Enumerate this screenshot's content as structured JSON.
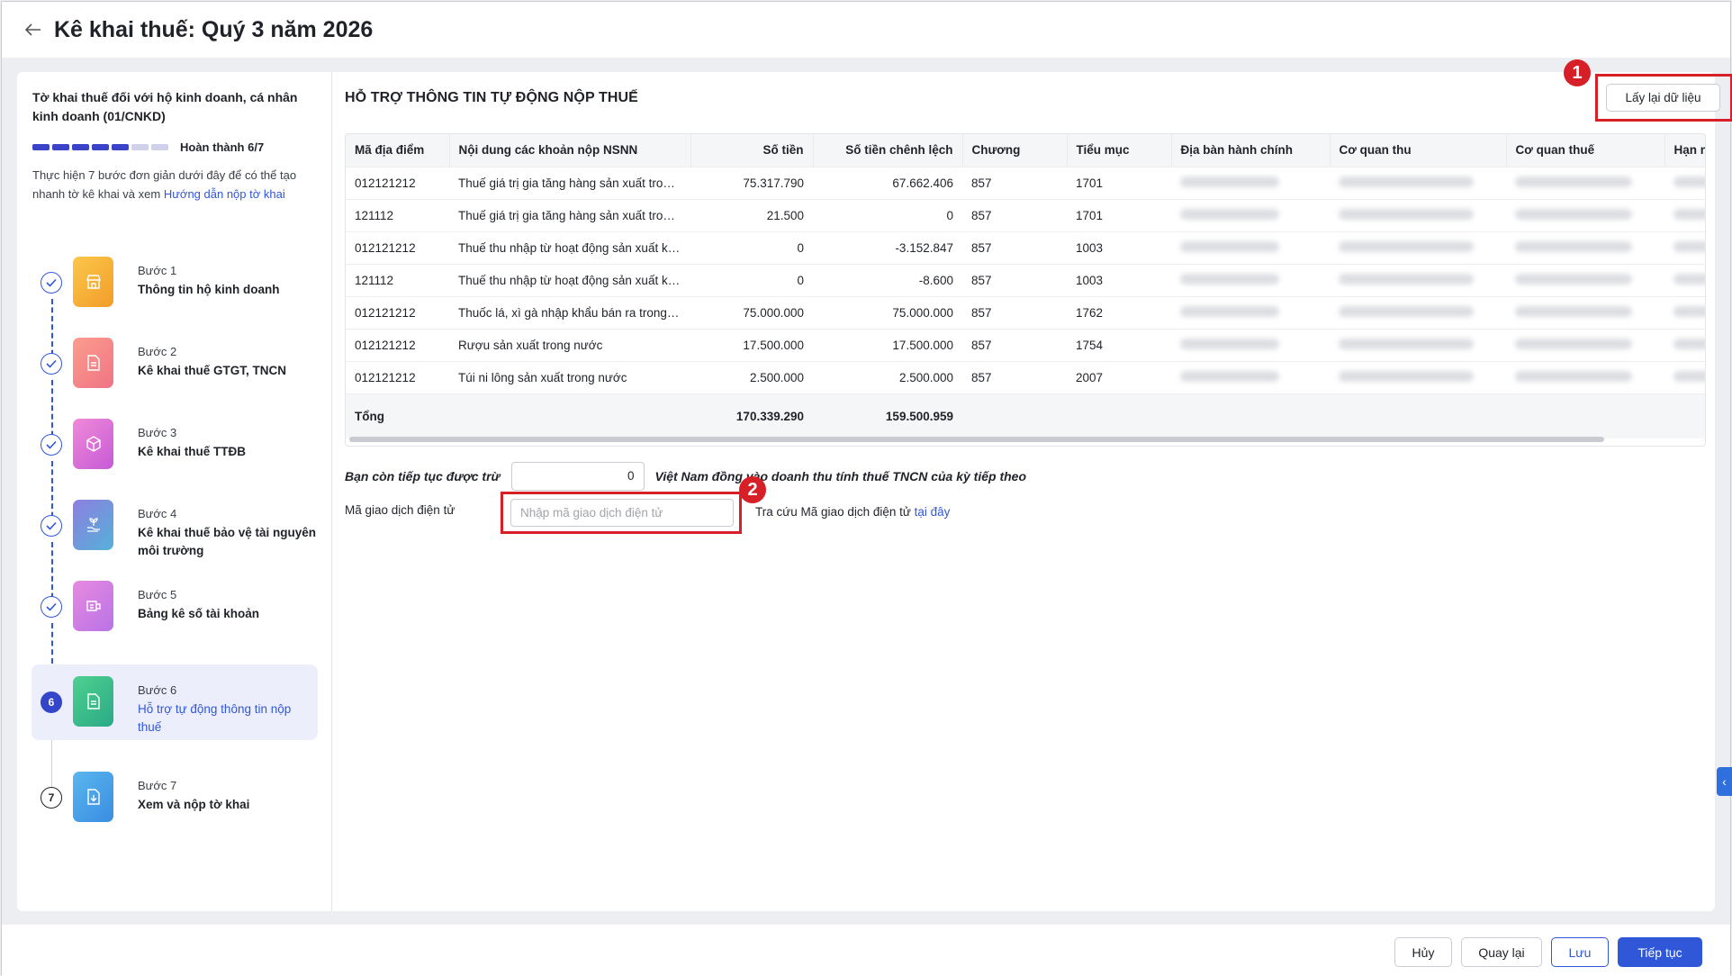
{
  "header": {
    "title": "Kê khai thuế: Quý 3 năm 2026"
  },
  "sidebar": {
    "form_title": "Tờ khai thuế đối với hộ kinh doanh, cá nhân kinh doanh (01/CNKD)",
    "progress": {
      "label": "Hoàn thành 6/7",
      "done": 6,
      "total": 7
    },
    "desc_prefix": "Thực hiện 7 bước đơn giản dưới đây để có thể tạo nhanh tờ kê khai và xem ",
    "desc_link": "Hướng dẫn nộp tờ khai",
    "steps": [
      {
        "label": "Bước 1",
        "name": "Thông tin hộ kinh doanh",
        "status": "done",
        "color": "#f7b23b"
      },
      {
        "label": "Bước 2",
        "name": "Kê khai thuế GTGT, TNCN",
        "status": "done",
        "color": "#f58a85"
      },
      {
        "label": "Bước 3",
        "name": "Kê khai thuế TTĐB",
        "status": "done",
        "color": "#e16fd0"
      },
      {
        "label": "Bước 4",
        "name": "Kê khai thuế bảo vệ tài nguyên môi trường",
        "status": "done",
        "color": "#7a86e0"
      },
      {
        "label": "Bước 5",
        "name": "Bảng kê số tài khoản",
        "status": "done",
        "color": "#d97fe0"
      },
      {
        "label": "Bước 6",
        "name": "Hỗ trợ tự động thông tin nộp thuế",
        "status": "active",
        "number": "6",
        "color": "#3fbf8a"
      },
      {
        "label": "Bước 7",
        "name": "Xem và nộp tờ khai",
        "status": "todo",
        "number": "7",
        "color": "#4aa6e8"
      }
    ]
  },
  "content": {
    "section_title": "HỖ TRỢ THÔNG TIN TỰ ĐỘNG NỘP THUẾ",
    "refetch_label": "Lấy lại dữ liệu",
    "badges": [
      "1",
      "2"
    ],
    "table": {
      "columns": [
        "Mã địa điểm",
        "Nội dung các khoản nộp NSNN",
        "Số tiền",
        "Số tiền chênh lệch",
        "Chương",
        "Tiểu mục",
        "Địa bàn hành chính",
        "Cơ quan thu",
        "Cơ quan thuế",
        "Hạn n"
      ],
      "rows": [
        [
          "012121212",
          "Thuế giá trị gia tăng hàng sản xuất trong nước",
          "75.317.790",
          "67.662.406",
          "857",
          "1701"
        ],
        [
          "121112",
          "Thuế giá trị gia tăng hàng sản xuất trong nước",
          "21.500",
          "0",
          "857",
          "1701"
        ],
        [
          "012121212",
          "Thuế thu nhập từ hoạt động sản xuất kinh doanh",
          "0",
          "-3.152.847",
          "857",
          "1003"
        ],
        [
          "121112",
          "Thuế thu nhập từ hoạt động sản xuất kinh doanh",
          "0",
          "-8.600",
          "857",
          "1003"
        ],
        [
          "012121212",
          "Thuốc lá, xì gà nhập khẩu bán ra trong nước",
          "75.000.000",
          "75.000.000",
          "857",
          "1762"
        ],
        [
          "012121212",
          "Rượu sản xuất trong nước",
          "17.500.000",
          "17.500.000",
          "857",
          "1754"
        ],
        [
          "012121212",
          "Túi ni lông sản xuất trong nước",
          "2.500.000",
          "2.500.000",
          "857",
          "2007"
        ]
      ],
      "total": {
        "label": "Tổng",
        "amount": "170.339.290",
        "diff": "159.500.959"
      }
    },
    "carry_over": {
      "prefix": "Bạn còn tiếp tục được trừ",
      "value": "0",
      "suffix": "Việt Nam đồng vào doanh thu tính thuế TNCN của kỳ tiếp theo"
    },
    "transaction": {
      "label": "Mã giao dịch điện tử",
      "placeholder": "Nhập mã giao dịch điện tử",
      "lookup_prefix": "Tra cứu Mã giao dịch điện tử ",
      "lookup_link": "tại đây"
    }
  },
  "footer": {
    "cancel": "Hủy",
    "back": "Quay lại",
    "save": "Lưu",
    "next": "Tiếp tục"
  },
  "colors": {
    "primary": "#3157d9",
    "highlight": "#d61f26"
  }
}
